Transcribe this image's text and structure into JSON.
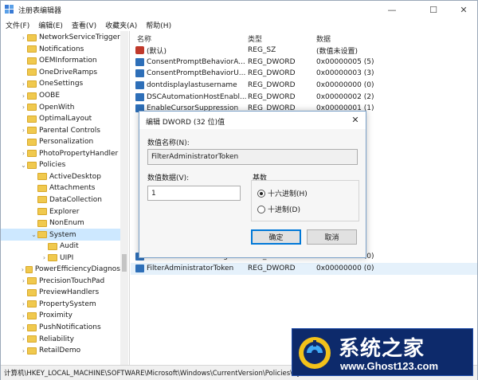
{
  "window": {
    "title": "注册表编辑器",
    "buttons": {
      "minimize": "—",
      "maximize": "☐",
      "close": "✕"
    }
  },
  "menu": [
    "文件(F)",
    "编辑(E)",
    "查看(V)",
    "收藏夹(A)",
    "帮助(H)"
  ],
  "tree": [
    {
      "label": "NetworkServiceTrigger",
      "level": 0,
      "chev": "›"
    },
    {
      "label": "Notifications",
      "level": 0,
      "chev": ""
    },
    {
      "label": "OEMInformation",
      "level": 0,
      "chev": ""
    },
    {
      "label": "OneDriveRamps",
      "level": 0,
      "chev": ""
    },
    {
      "label": "OneSettings",
      "level": 0,
      "chev": "›"
    },
    {
      "label": "OOBE",
      "level": 0,
      "chev": "›"
    },
    {
      "label": "OpenWith",
      "level": 0,
      "chev": "›"
    },
    {
      "label": "OptimalLayout",
      "level": 0,
      "chev": ""
    },
    {
      "label": "Parental Controls",
      "level": 0,
      "chev": "›"
    },
    {
      "label": "Personalization",
      "level": 0,
      "chev": ""
    },
    {
      "label": "PhotoPropertyHandler",
      "level": 0,
      "chev": "›"
    },
    {
      "label": "Policies",
      "level": 0,
      "chev": "⌄"
    },
    {
      "label": "ActiveDesktop",
      "level": 1,
      "chev": ""
    },
    {
      "label": "Attachments",
      "level": 1,
      "chev": ""
    },
    {
      "label": "DataCollection",
      "level": 1,
      "chev": ""
    },
    {
      "label": "Explorer",
      "level": 1,
      "chev": ""
    },
    {
      "label": "NonEnum",
      "level": 1,
      "chev": ""
    },
    {
      "label": "System",
      "level": 1,
      "chev": "⌄",
      "selected": true
    },
    {
      "label": "Audit",
      "level": 2,
      "chev": ""
    },
    {
      "label": "UIPI",
      "level": 2,
      "chev": "›"
    },
    {
      "label": "PowerEfficiencyDiagnos",
      "level": 0,
      "chev": "›"
    },
    {
      "label": "PrecisionTouchPad",
      "level": 0,
      "chev": "›"
    },
    {
      "label": "PreviewHandlers",
      "level": 0,
      "chev": ""
    },
    {
      "label": "PropertySystem",
      "level": 0,
      "chev": "›"
    },
    {
      "label": "Proximity",
      "level": 0,
      "chev": "›"
    },
    {
      "label": "PushNotifications",
      "level": 0,
      "chev": "›"
    },
    {
      "label": "Reliability",
      "level": 0,
      "chev": "›"
    },
    {
      "label": "RetailDemo",
      "level": 0,
      "chev": "›"
    }
  ],
  "columns": {
    "name": "名称",
    "type": "类型",
    "data": "数据"
  },
  "values": [
    {
      "icon": "ab",
      "name": "(默认)",
      "type": "REG_SZ",
      "data": "(数值未设置)"
    },
    {
      "icon": "bin",
      "name": "ConsentPromptBehaviorA...",
      "type": "REG_DWORD",
      "data": "0x00000005 (5)"
    },
    {
      "icon": "bin",
      "name": "ConsentPromptBehaviorU...",
      "type": "REG_DWORD",
      "data": "0x00000003 (3)"
    },
    {
      "icon": "bin",
      "name": "dontdisplaylastusername",
      "type": "REG_DWORD",
      "data": "0x00000000 (0)"
    },
    {
      "icon": "bin",
      "name": "DSCAutomationHostEnabl...",
      "type": "REG_DWORD",
      "data": "0x00000002 (2)"
    },
    {
      "icon": "bin",
      "name": "EnableCursorSuppression",
      "type": "REG_DWORD",
      "data": "0x00000001 (1)"
    }
  ],
  "values_bottom": [
    {
      "icon": "bin",
      "name": "ValidateAdminCodeSignat...",
      "type": "REG_DWORD",
      "data": "0x00000000 (0)"
    },
    {
      "icon": "bin",
      "name": "FilterAdministratorToken",
      "type": "REG_DWORD",
      "data": "0x00000000 (0)",
      "highlight": true
    }
  ],
  "status_path": "计算机\\HKEY_LOCAL_MACHINE\\SOFTWARE\\Microsoft\\Windows\\CurrentVersion\\Policies\\System",
  "dialog": {
    "title": "编辑 DWORD (32 位)值",
    "close": "✕",
    "name_label": "数值名称(N):",
    "name_value": "FilterAdministratorToken",
    "data_label": "数值数据(V):",
    "data_value": "1",
    "base_label": "基数",
    "hex_label": "十六进制(H)",
    "dec_label": "十进制(D)",
    "base_selected": "hex",
    "ok": "确定",
    "cancel": "取消"
  },
  "watermark": {
    "title": "系统之家",
    "url": "www.Ghost123.com"
  }
}
